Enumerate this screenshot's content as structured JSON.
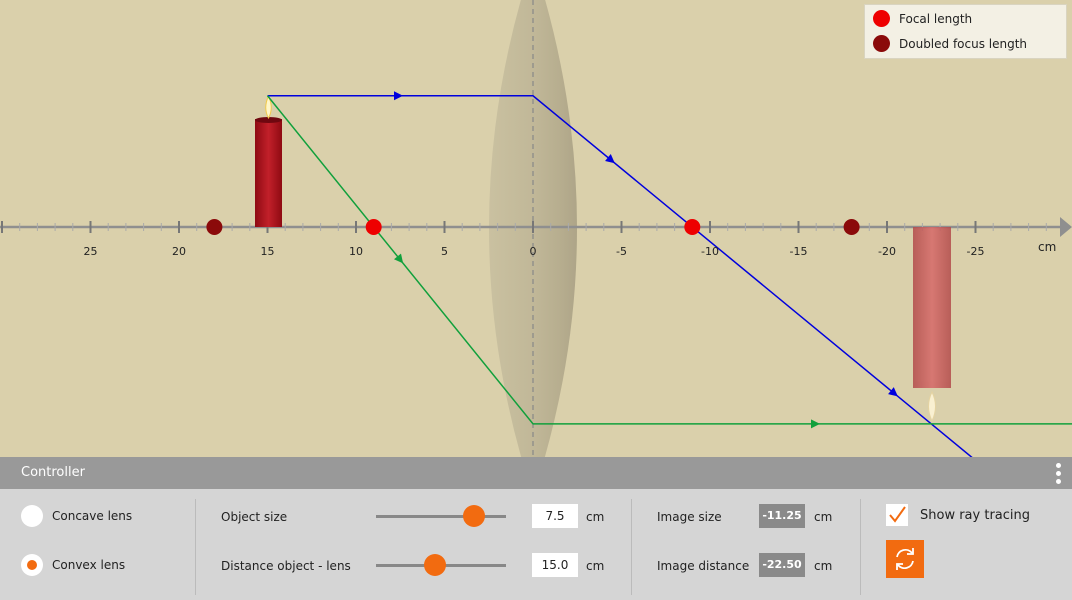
{
  "legend": {
    "focal": {
      "label": "Focal length",
      "color": "#ee0000"
    },
    "doubled": {
      "label": "Doubled focus length",
      "color": "#8b0a0a"
    }
  },
  "axis": {
    "unit": "cm",
    "tick_labels": [
      {
        "value": 25,
        "text": "25"
      },
      {
        "value": 20,
        "text": "20"
      },
      {
        "value": 15,
        "text": "15"
      },
      {
        "value": 10,
        "text": "10"
      },
      {
        "value": 5,
        "text": "5"
      },
      {
        "value": 0,
        "text": "0"
      },
      {
        "value": -5,
        "text": "-5"
      },
      {
        "value": -10,
        "text": "-10"
      },
      {
        "value": -15,
        "text": "-15"
      },
      {
        "value": -20,
        "text": "-20"
      },
      {
        "value": -25,
        "text": "-25"
      }
    ]
  },
  "optics": {
    "lens_type": "convex",
    "object_distance": 15.0,
    "object_size": 7.5,
    "image_distance": -22.5,
    "image_size": -11.25,
    "focal_points": [
      9,
      -9
    ],
    "doubled_focal_points": [
      18,
      -18
    ],
    "ray_colors": {
      "parallel_ray": "#0000dd",
      "center_ray": "#11a03c"
    }
  },
  "controller": {
    "title": "Controller",
    "concave_label": "Concave lens",
    "convex_label": "Convex lens",
    "object_size_label": "Object size",
    "object_size_value": "7.5",
    "object_size_slider": 0.75,
    "distance_label": "Distance object - lens",
    "distance_value": "15.0",
    "distance_slider": 0.45,
    "unit": "cm",
    "image_size_label": "Image size",
    "image_size_value": "-11.25",
    "image_distance_label": "Image distance",
    "image_distance_value": "-22.50",
    "show_ray_tracing_label": "Show ray tracing",
    "show_ray_tracing": true,
    "accent": "#f26b10"
  }
}
